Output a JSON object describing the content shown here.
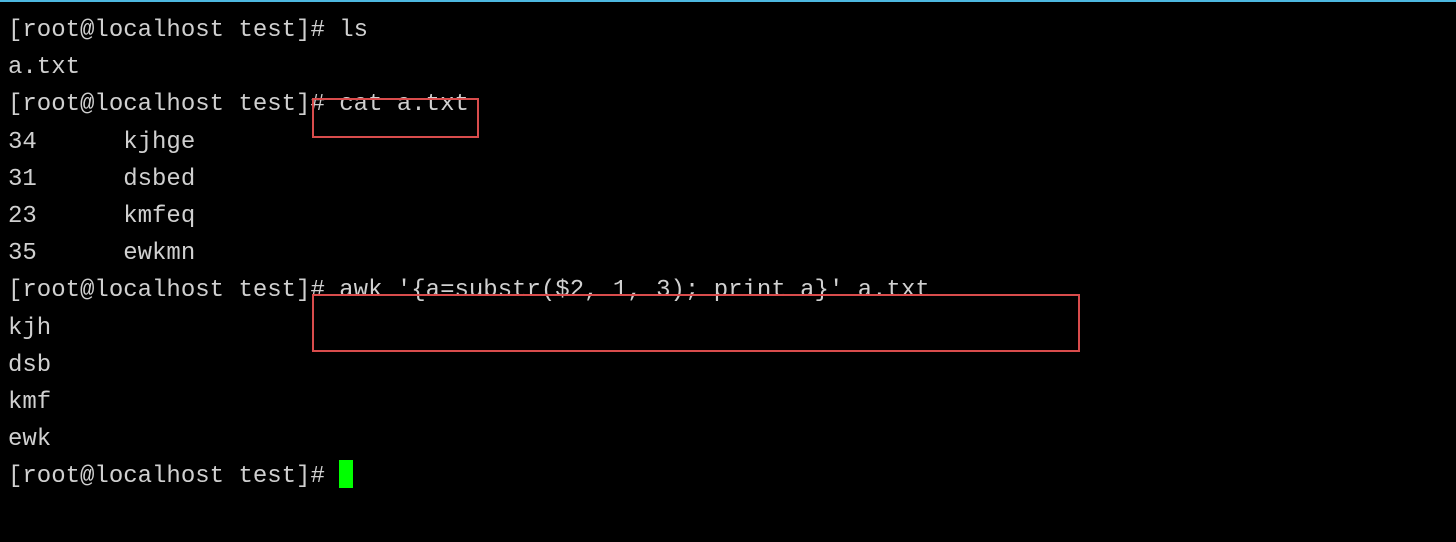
{
  "prompt": "[root@localhost test]# ",
  "cmd1": "ls",
  "out1": "a.txt",
  "cmd2": "cat a.txt",
  "out2_l1": "34      kjhge",
  "out2_l2": "31      dsbed",
  "out2_l3": "23      kmfeq",
  "out2_l4": "35      ewkmn",
  "cmd3": "awk '{a=substr($2, 1, 3); print a}' a.txt",
  "out3_l1": "kjh",
  "out3_l2": "dsb",
  "out3_l3": "kmf",
  "out3_l4": "ewk",
  "highlight_box_color": "#d94c4c",
  "cursor_color": "#00ff00"
}
